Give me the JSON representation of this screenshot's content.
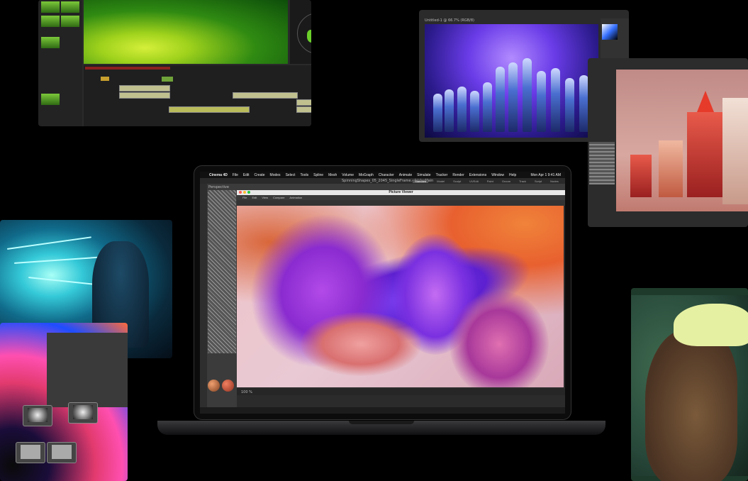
{
  "laptop": {
    "menubar": {
      "apple": "",
      "app_name": "Cinema 4D",
      "items": [
        "File",
        "Edit",
        "Create",
        "Modes",
        "Select",
        "Tools",
        "Spline",
        "Mesh",
        "Volume",
        "MoGraph",
        "Character",
        "Animate",
        "Simulate",
        "Tracker",
        "Render",
        "Extensions",
        "Window",
        "Help"
      ],
      "clock": "Mon Apr 1  9:41 AM"
    },
    "document_title": "SpinningShapes_05_2045_SingleFrame.c4d * - Main",
    "tabs": [
      "Standard",
      "Model",
      "Sculpt",
      "UVEdit",
      "Paint",
      "Groom",
      "Track",
      "Script",
      "Nodes"
    ],
    "active_tab": "Standard",
    "picture_viewer": {
      "title": "Picture Viewer",
      "menu": [
        "File",
        "Edit",
        "View",
        "Compare",
        "Animation"
      ],
      "zoom": "100 %"
    },
    "sidebar_label": "Perspective"
  },
  "photoshop": {
    "doc_tab": "Untitled-1 @ 66.7% (RGB/8)"
  },
  "colors": {
    "background": "#000000",
    "accent_green": "#6bcf2a",
    "purple": "#7b3ff0"
  }
}
